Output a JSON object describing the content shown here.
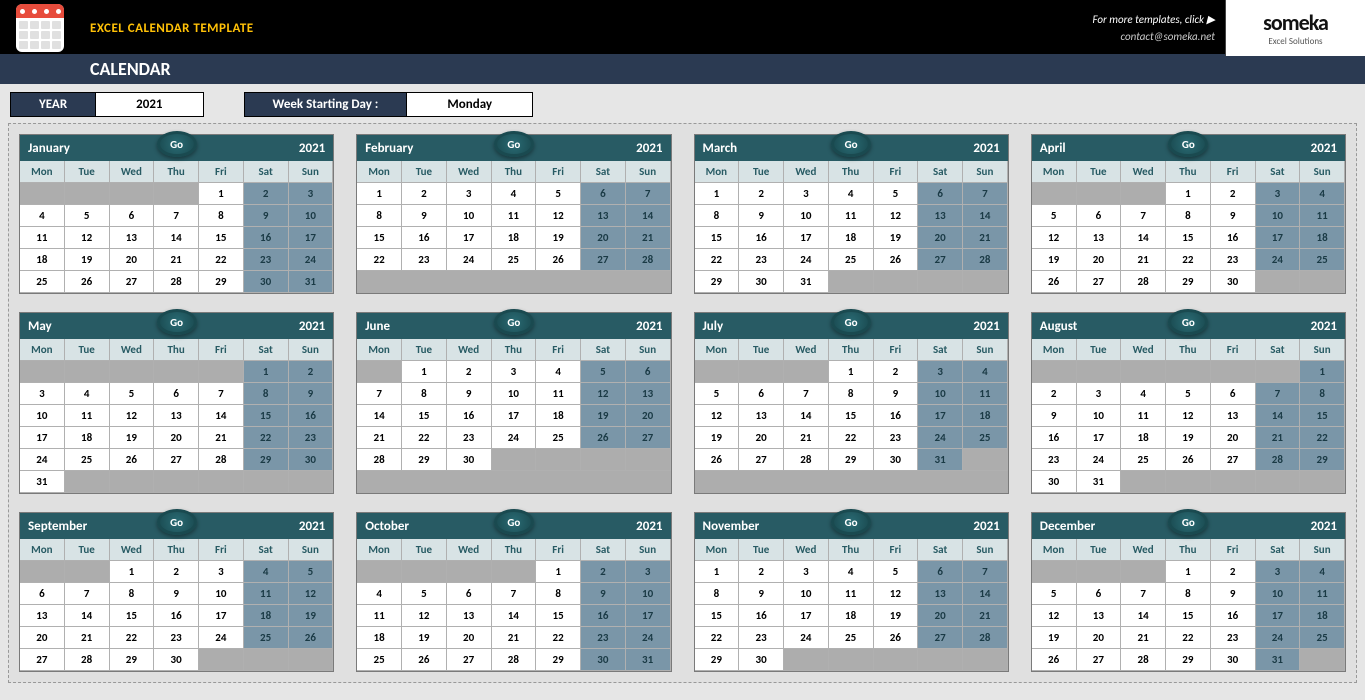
{
  "header": {
    "template_title": "EXCEL CALENDAR TEMPLATE",
    "page_title": "CALENDAR",
    "link_text": "For more templates, click ▶",
    "contact": "contact@someka.net",
    "brand_name": "someka",
    "brand_tag": "Excel Solutions"
  },
  "controls": {
    "year_label": "YEAR",
    "year_value": "2021",
    "week_label": "Week Starting Day :",
    "week_value": "Monday"
  },
  "dow": [
    "Mon",
    "Tue",
    "Wed",
    "Thu",
    "Fri",
    "Sat",
    "Sun"
  ],
  "go_label": "Go",
  "months": [
    {
      "name": "January",
      "year": "2021",
      "start": 4,
      "days": 31
    },
    {
      "name": "February",
      "year": "2021",
      "start": 0,
      "days": 28
    },
    {
      "name": "March",
      "year": "2021",
      "start": 0,
      "days": 31
    },
    {
      "name": "April",
      "year": "2021",
      "start": 3,
      "days": 30
    },
    {
      "name": "May",
      "year": "2021",
      "start": 5,
      "days": 31
    },
    {
      "name": "June",
      "year": "2021",
      "start": 1,
      "days": 30
    },
    {
      "name": "July",
      "year": "2021",
      "start": 3,
      "days": 31
    },
    {
      "name": "August",
      "year": "2021",
      "start": 6,
      "days": 31
    },
    {
      "name": "September",
      "year": "2021",
      "start": 2,
      "days": 30
    },
    {
      "name": "October",
      "year": "2021",
      "start": 4,
      "days": 31
    },
    {
      "name": "November",
      "year": "2021",
      "start": 0,
      "days": 30
    },
    {
      "name": "December",
      "year": "2021",
      "start": 3,
      "days": 31
    }
  ]
}
